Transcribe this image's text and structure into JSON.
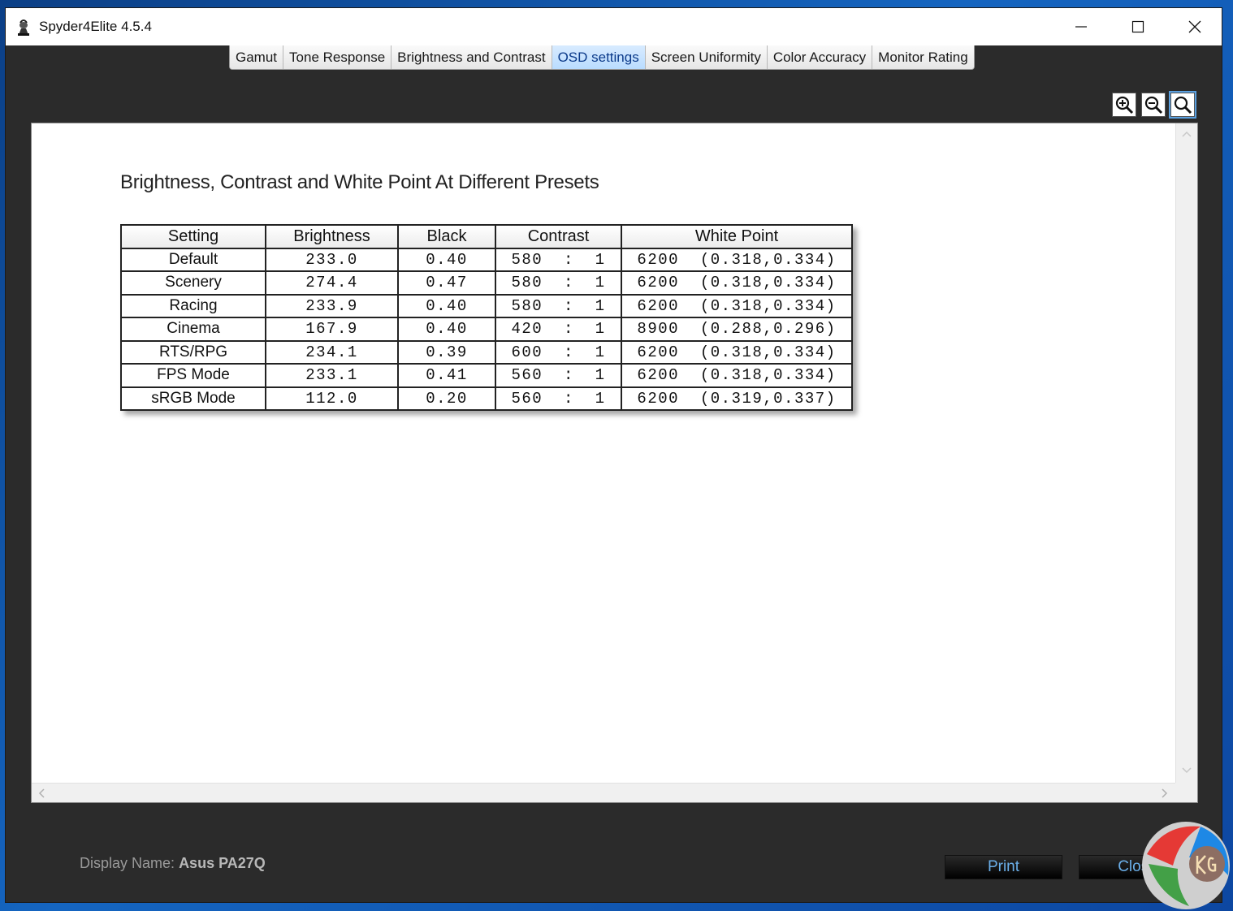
{
  "window": {
    "title": "Spyder4Elite 4.5.4"
  },
  "tabs": [
    {
      "label": "Gamut",
      "active": false
    },
    {
      "label": "Tone Response",
      "active": false
    },
    {
      "label": "Brightness and Contrast",
      "active": false
    },
    {
      "label": "OSD settings",
      "active": true
    },
    {
      "label": "Screen Uniformity",
      "active": false
    },
    {
      "label": "Color Accuracy",
      "active": false
    },
    {
      "label": "Monitor Rating",
      "active": false
    }
  ],
  "toolbar": {
    "icons": [
      "zoom-in-icon",
      "zoom-out-icon",
      "zoom-fit-icon"
    ]
  },
  "report": {
    "title": "Brightness, Contrast and White Point At Different Presets",
    "columns": [
      "Setting",
      "Brightness",
      "Black",
      "Contrast",
      "White Point"
    ],
    "rows": [
      {
        "setting": "Default",
        "brightness": "233.0",
        "black": "0.40",
        "contrast": "580  :  1",
        "white_point": "6200  (0.318,0.334)"
      },
      {
        "setting": "Scenery",
        "brightness": "274.4",
        "black": "0.47",
        "contrast": "580  :  1",
        "white_point": "6200  (0.318,0.334)"
      },
      {
        "setting": "Racing",
        "brightness": "233.9",
        "black": "0.40",
        "contrast": "580  :  1",
        "white_point": "6200  (0.318,0.334)"
      },
      {
        "setting": "Cinema",
        "brightness": "167.9",
        "black": "0.40",
        "contrast": "420  :  1",
        "white_point": "8900  (0.288,0.296)"
      },
      {
        "setting": "RTS/RPG",
        "brightness": "234.1",
        "black": "0.39",
        "contrast": "600  :  1",
        "white_point": "6200  (0.318,0.334)"
      },
      {
        "setting": "FPS Mode",
        "brightness": "233.1",
        "black": "0.41",
        "contrast": "560  :  1",
        "white_point": "6200  (0.318,0.334)"
      },
      {
        "setting": "sRGB Mode",
        "brightness": "112.0",
        "black": "0.20",
        "contrast": "560  :  1",
        "white_point": "6200  (0.319,0.337)"
      }
    ]
  },
  "footer": {
    "display_label": "Display Name:",
    "display_value": "Asus PA27Q",
    "print_label": "Print",
    "close_label": "Close"
  },
  "colors": {
    "accent": "#6aaee8",
    "active_tab": "#b9dcff",
    "window_bg": "#2b2b2b"
  }
}
